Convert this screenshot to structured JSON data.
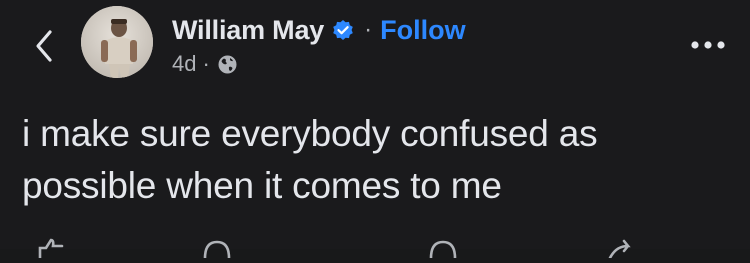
{
  "post": {
    "author": {
      "name": "William May",
      "verified_icon": "verified-badge-icon",
      "avatar_icon": "avatar"
    },
    "separator": "·",
    "follow_label": "Follow",
    "timestamp": "4d",
    "meta_separator": "·",
    "audience_icon": "globe-icon",
    "text": "i make sure everybody confused as possible when it comes to me"
  },
  "nav": {
    "back_icon": "chevron-left-icon",
    "more_icon": "more-horizontal-icon"
  },
  "actions": [
    {
      "icon": "like-icon"
    },
    {
      "icon": "comment-icon"
    },
    {
      "icon": "send-icon"
    },
    {
      "icon": "share-icon"
    }
  ],
  "colors": {
    "background": "#1a1a1c",
    "text": "#e4e6eb",
    "secondary": "#b0b3b8",
    "link": "#2d88ff"
  }
}
